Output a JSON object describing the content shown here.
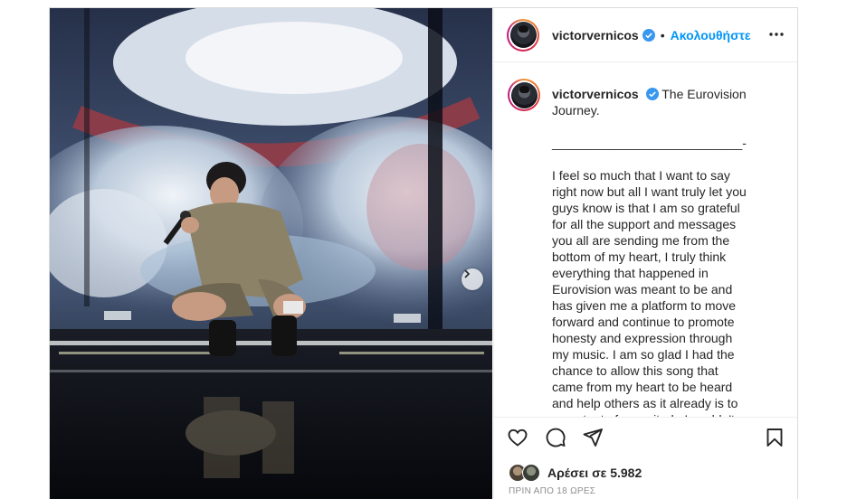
{
  "post": {
    "username": "victorvernicos",
    "follow_label": "Ακολουθήστε",
    "separator": "•",
    "caption_title": "The Eurovision Journey.",
    "caption_divider": "___________________________-",
    "caption_body": "I feel so much that I want to say right now but all I want truly let you guys know is that I am so grateful for all the support and messages you all are sending me from the bottom of my heart, I truly think everything that happened in Eurovision was meant to be and has given me a platform to move forward and continue to promote honesty and expression through my music. I am so glad I had the chance to allow this song that came from my heart to be heard and help others as it already is to an extent of magnitude I couldn't have even imagined. There is so much in store",
    "likes_text": "Αρέσει σε 5.982",
    "timestamp": "ΠΡΙΝ ΑΠΟ 18 ΩΡΕΣ"
  },
  "icons": {
    "verified": "verified-badge-icon",
    "more": "more-options-icon",
    "next": "chevron-right-icon",
    "like": "heart-icon",
    "comment": "comment-icon",
    "share": "paper-plane-icon",
    "save": "bookmark-icon"
  },
  "colors": {
    "accent": "#0095f6",
    "text": "#262626",
    "muted": "#8e8e8e",
    "border": "#dbdbdb"
  }
}
